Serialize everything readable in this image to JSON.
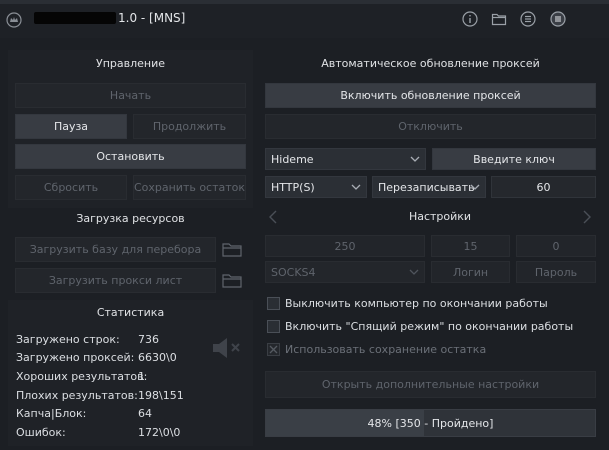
{
  "titlebar": {
    "title": "1.0 - [MNS]",
    "icons": [
      "crown-icon",
      "info-icon",
      "folder-icon",
      "list-icon",
      "menu-icon"
    ]
  },
  "control": {
    "header": "Управление",
    "start": "Начать",
    "pause": "Пауза",
    "resume": "Продолжить",
    "stop": "Остановить",
    "reset": "Сбросить",
    "save_rest": "Сохранить остаток"
  },
  "resources": {
    "header": "Загрузка ресурсов",
    "load_base": "Загрузить базу для перебора",
    "load_proxy": "Загрузить прокси лист"
  },
  "stats": {
    "header": "Статистика",
    "rows": [
      {
        "label": "Загружено строк:",
        "value": "736"
      },
      {
        "label": "Загружено проксей:",
        "value": "6630\\0"
      },
      {
        "label": "Хороших результатов:",
        "value": "1"
      },
      {
        "label": "Плохих результатов:",
        "value": "198\\151"
      },
      {
        "label": "Капча|Блок:",
        "value": "64"
      },
      {
        "label": "Ошибок:",
        "value": "172\\0\\0"
      }
    ]
  },
  "proxy_update": {
    "header": "Автоматическое обновление проксей",
    "enable": "Включить обновление проксей",
    "disable": "Отключить",
    "source_select": "Hideme",
    "key_button": "Введите ключ",
    "protocol_select": "HTTP(S)",
    "mode_select": "Перезаписывать",
    "interval_value": "60"
  },
  "settings": {
    "header": "Настройки",
    "threads": "250",
    "timeout": "15",
    "retries": "0",
    "proxy_type": "SOCKS4",
    "login": "Логин",
    "password": "Пароль",
    "shutdown_label": "Выключить компьютер по окончании работы",
    "sleep_label": "Включить \"Спящий режим\" по окончании работы",
    "save_rest_label": "Использовать сохранение остатка",
    "more_settings": "Открыть дополнительные настройки"
  },
  "progress": {
    "percent": 48,
    "text": "48% [350 - Пройдено]"
  },
  "colors": {
    "bg": "#1c1f24",
    "button": "#2b2f35",
    "disabled_text": "#5f646c"
  }
}
